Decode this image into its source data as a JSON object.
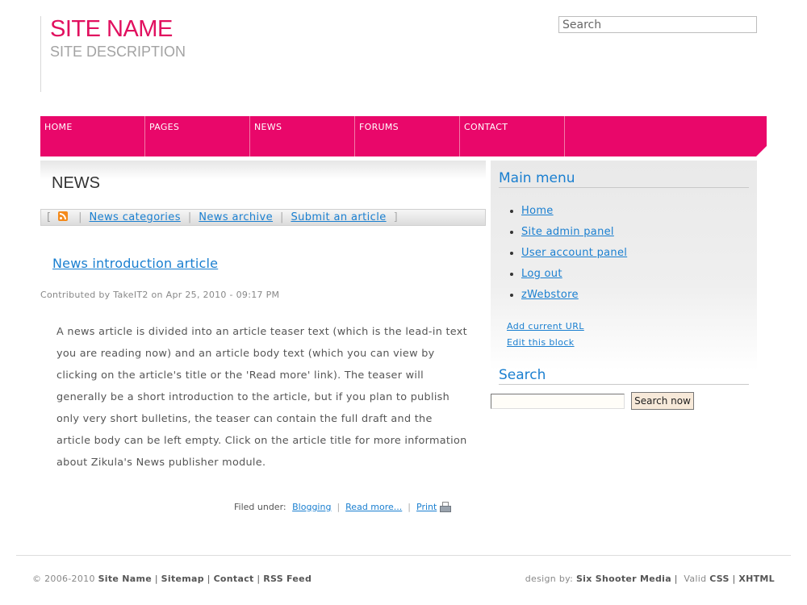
{
  "header": {
    "site_name": "SITE NAME",
    "site_description": "SITE DESCRIPTION",
    "search_placeholder": "Search"
  },
  "nav": {
    "items": [
      {
        "label": "HOME"
      },
      {
        "label": "PAGES"
      },
      {
        "label": "NEWS"
      },
      {
        "label": "FORUMS"
      },
      {
        "label": "CONTACT"
      }
    ]
  },
  "news": {
    "title": "NEWS",
    "links": {
      "open_bracket": "[",
      "categories": "News categories",
      "archive": "News archive",
      "submit": "Submit an article",
      "separator": "|",
      "close_bracket": "]"
    }
  },
  "article": {
    "title": "News introduction article",
    "meta": "Contributed by TakeIT2 on Apr 25, 2010 - 09:17 PM",
    "body": "A news article is divided into an article teaser text (which is the lead-in text you are reading now) and an article body text (which you can view by clicking on the article's title or the 'Read more' link). The teaser will generally be a short introduction to the article, but if you plan to publish only very short bulletins, the teaser can contain the full draft and the article body can be left empty. Click on the article title for more information about Zikula's News publisher module.",
    "footer": {
      "filed_under": "Filed under:",
      "category": "Blogging",
      "read_more": "Read more...",
      "print": "Print",
      "separator": "|"
    }
  },
  "sidebar": {
    "menu_title": "Main menu",
    "menu_items": [
      {
        "label": "Home"
      },
      {
        "label": "Site admin panel"
      },
      {
        "label": "User account panel"
      },
      {
        "label": "Log out"
      },
      {
        "label": "zWebstore"
      }
    ],
    "add_url": "Add current URL",
    "edit_block": "Edit this block",
    "search_title": "Search",
    "search_value": "",
    "search_button": "Search now"
  },
  "footer": {
    "copyright": "© 2006-2010",
    "site_name": "Site Name",
    "sitemap": "Sitemap",
    "contact": "Contact",
    "rss": "RSS Feed",
    "separator": "|",
    "design_by": "design by:",
    "designer": "Six Shooter Media",
    "valid": "Valid",
    "css": "CSS",
    "xhtml": "XHTML"
  },
  "colors": {
    "brand": "#e9076a",
    "site_name": "#e1105f",
    "link": "#1a7fd0"
  }
}
